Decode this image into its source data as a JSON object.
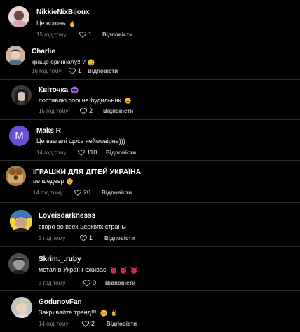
{
  "comments": [
    {
      "author": "NikkieNixBijoux",
      "text": "Це вогонь",
      "emoji": "fire-emoji",
      "time": "15 год тому",
      "likes": "1",
      "reply": "Відповісти"
    },
    {
      "author": "Charlie",
      "text": "краще оригіналу!! ?",
      "emoji": "sticker-emoji",
      "time": "16 год тому",
      "likes": "1",
      "reply": "Відповісти"
    },
    {
      "author": "Квіточка",
      "badge_icon": "purple-face-emoji",
      "text": "поставлю собі на будильник",
      "emoji": "grin-emoji",
      "time": "15 год тому",
      "likes": "2",
      "reply": "Відповісти"
    },
    {
      "author": "Maks R",
      "avatar_letter": "M",
      "text": "Це взагалі щось неймовірне)))",
      "time": "14 год тому",
      "likes": "110",
      "reply": "Відповісти"
    },
    {
      "author": "ІГРАШКИ ДЛЯ ДІТЕЙ УКРАЇНА",
      "text": "це шедевр",
      "emoji": "grin-emoji",
      "time": "14 год тому",
      "likes": "20",
      "reply": "Відповісти"
    },
    {
      "author": "Loveisdarknesss",
      "text": "скоро во всех церквях страны",
      "time": "2 год тому",
      "likes": "1",
      "reply": "Відповісти"
    },
    {
      "author": "Skrim._.ruby",
      "text": "метал в Україні оживає",
      "emoji": "devil-emoji",
      "time": "3 год тому",
      "likes": "0",
      "reply": "Відповісти"
    },
    {
      "author": "GodunovFan",
      "text": "Закривайте тренд!!!",
      "emoji": "laugh-emoji",
      "time": "14 год тому",
      "likes": "2",
      "reply": "Відповісти"
    }
  ],
  "colors": {
    "background": "#000000",
    "meta_text": "#8a8a8a",
    "avatar_maks": "#6b4fd6",
    "devil_emoji": "#e0245e"
  }
}
